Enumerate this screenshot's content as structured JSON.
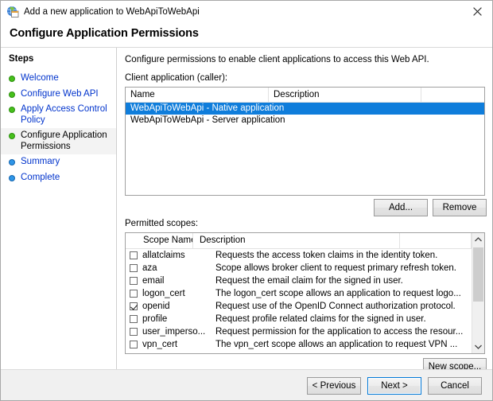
{
  "window": {
    "title": "Add a new application to WebApiToWebApi",
    "icon": "adfs-application-icon",
    "close_label": "✕"
  },
  "page": {
    "header": "Configure Application Permissions",
    "intro": "Configure permissions to enable client applications to access this Web API."
  },
  "sidebar": {
    "title": "Steps",
    "items": [
      {
        "label": "Welcome",
        "state": "done"
      },
      {
        "label": "Configure Web API",
        "state": "done"
      },
      {
        "label": "Apply Access Control Policy",
        "state": "done"
      },
      {
        "label": "Configure Application Permissions",
        "state": "active"
      },
      {
        "label": "Summary",
        "state": "todo"
      },
      {
        "label": "Complete",
        "state": "todo"
      }
    ]
  },
  "client_section": {
    "label": "Client application (caller):",
    "columns": [
      "Name",
      "Description"
    ],
    "rows": [
      {
        "name": "WebApiToWebApi - Native application",
        "description": "",
        "selected": true
      },
      {
        "name": "WebApiToWebApi - Server application",
        "description": "",
        "selected": false
      }
    ],
    "add_button": "Add...",
    "remove_button": "Remove"
  },
  "scopes_section": {
    "label": "Permitted scopes:",
    "columns": [
      "Scope Name",
      "Description"
    ],
    "rows": [
      {
        "checked": false,
        "name": "allatclaims",
        "description": "Requests the access token claims in the identity token."
      },
      {
        "checked": false,
        "name": "aza",
        "description": "Scope allows broker client to request primary refresh token."
      },
      {
        "checked": false,
        "name": "email",
        "description": "Request the email claim for the signed in user."
      },
      {
        "checked": false,
        "name": "logon_cert",
        "description": "The logon_cert scope allows an application to request logo..."
      },
      {
        "checked": true,
        "name": "openid",
        "description": "Request use of the OpenID Connect authorization protocol."
      },
      {
        "checked": false,
        "name": "profile",
        "description": "Request profile related claims for the signed in user."
      },
      {
        "checked": false,
        "name": "user_imperso...",
        "description": "Request permission for the application to access the resour..."
      },
      {
        "checked": false,
        "name": "vpn_cert",
        "description": "The vpn_cert scope allows an application to request VPN ..."
      }
    ],
    "new_scope_button": "New scope...",
    "scroll_up": "⌃",
    "scroll_down": "⌄"
  },
  "footer": {
    "previous": "< Previous",
    "next": "Next >",
    "cancel": "Cancel"
  },
  "colors": {
    "selection_blue": "#0f7ddb",
    "link_blue": "#0033cc",
    "step_done_green": "#46c01b",
    "step_todo_blue": "#2f96e8",
    "focus_border": "#0078d7"
  }
}
